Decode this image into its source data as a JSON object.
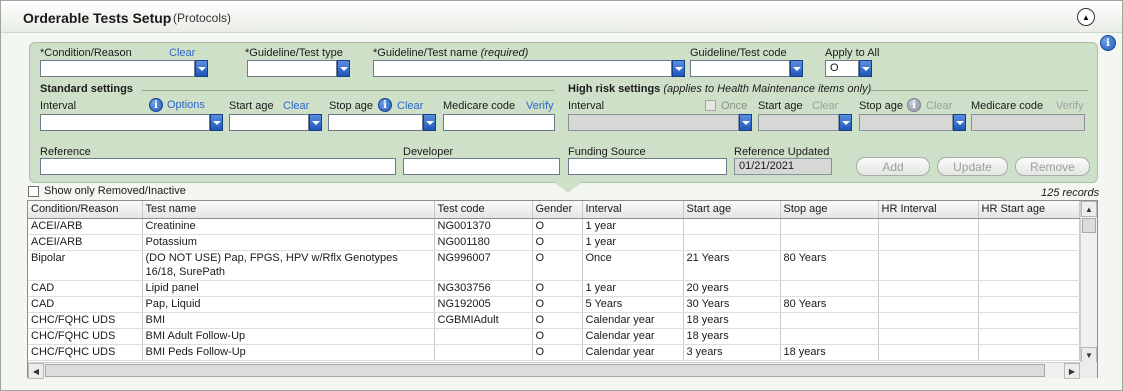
{
  "header": {
    "title": "Orderable Tests Setup",
    "subtitle": "(Protocols)"
  },
  "form": {
    "condition_label": "*Condition/Reason",
    "condition_clear": "Clear",
    "condition_value": "",
    "guideline_type_label": "*Guideline/Test type",
    "guideline_type_value": "",
    "guideline_name_label": "*Guideline/Test name",
    "guideline_name_hint": "(required)",
    "guideline_name_value": "",
    "guideline_code_label": "Guideline/Test code",
    "guideline_code_value": "",
    "apply_all_label": "Apply to All",
    "apply_all_value": "O",
    "standard": {
      "header": "Standard settings",
      "interval_label": "Interval",
      "options_link": "Options",
      "start_age_label": "Start age",
      "start_age_clear": "Clear",
      "stop_age_label": "Stop age",
      "stop_age_clear": "Clear",
      "medicare_label": "Medicare code",
      "verify_link": "Verify"
    },
    "high_risk": {
      "header": "High risk settings",
      "note": "(applies to Health Maintenance items only)",
      "interval_label": "Interval",
      "once_label": "Once",
      "start_age_label": "Start age",
      "start_age_clear": "Clear",
      "stop_age_label": "Stop age",
      "stop_age_clear": "Clear",
      "medicare_label": "Medicare code",
      "verify_link": "Verify"
    },
    "reference_label": "Reference",
    "developer_label": "Developer",
    "funding_label": "Funding Source",
    "ref_updated_label": "Reference Updated",
    "ref_updated_value": "01/21/2021",
    "add_label": "Add",
    "update_label": "Update",
    "remove_label": "Remove"
  },
  "filter": {
    "show_removed_label": "Show only Removed/Inactive",
    "records": "125 records"
  },
  "table": {
    "columns": [
      "Condition/Reason",
      "Test name",
      "Test code",
      "Gender",
      "Interval",
      "Start age",
      "Stop age",
      "HR Interval",
      "HR Start age"
    ],
    "rows": [
      [
        "ACEI/ARB",
        "Creatinine",
        "NG001370",
        "O",
        "1 year",
        "",
        "",
        "",
        ""
      ],
      [
        "ACEI/ARB",
        "Potassium",
        "NG001180",
        "O",
        "1 year",
        "",
        "",
        "",
        ""
      ],
      [
        "Bipolar",
        "(DO NOT USE) Pap, FPGS, HPV w/Rflx Genotypes 16/18, SurePath",
        "NG996007",
        "O",
        "Once",
        "21 Years",
        "80 Years",
        "",
        ""
      ],
      [
        "CAD",
        "Lipid panel",
        "NG303756",
        "O",
        "1 year",
        "20 years",
        "",
        "",
        ""
      ],
      [
        "CAD",
        "Pap, Liquid",
        "NG192005",
        "O",
        "5 Years",
        "30 Years",
        "80 Years",
        "",
        ""
      ],
      [
        "CHC/FQHC UDS",
        "BMI",
        "CGBMIAdult",
        "O",
        "Calendar year",
        "18 years",
        "",
        "",
        ""
      ],
      [
        "CHC/FQHC UDS",
        "BMI Adult Follow-Up",
        "",
        "O",
        "Calendar year",
        "18 years",
        "",
        "",
        ""
      ],
      [
        "CHC/FQHC UDS",
        "BMI Peds Follow-Up",
        "",
        "O",
        "Calendar year",
        "3 years",
        "18 years",
        "",
        ""
      ]
    ]
  },
  "colors": {
    "panel": "#cfe0c9",
    "link": "#2f66c8",
    "dropdown": "#1f56b8"
  }
}
